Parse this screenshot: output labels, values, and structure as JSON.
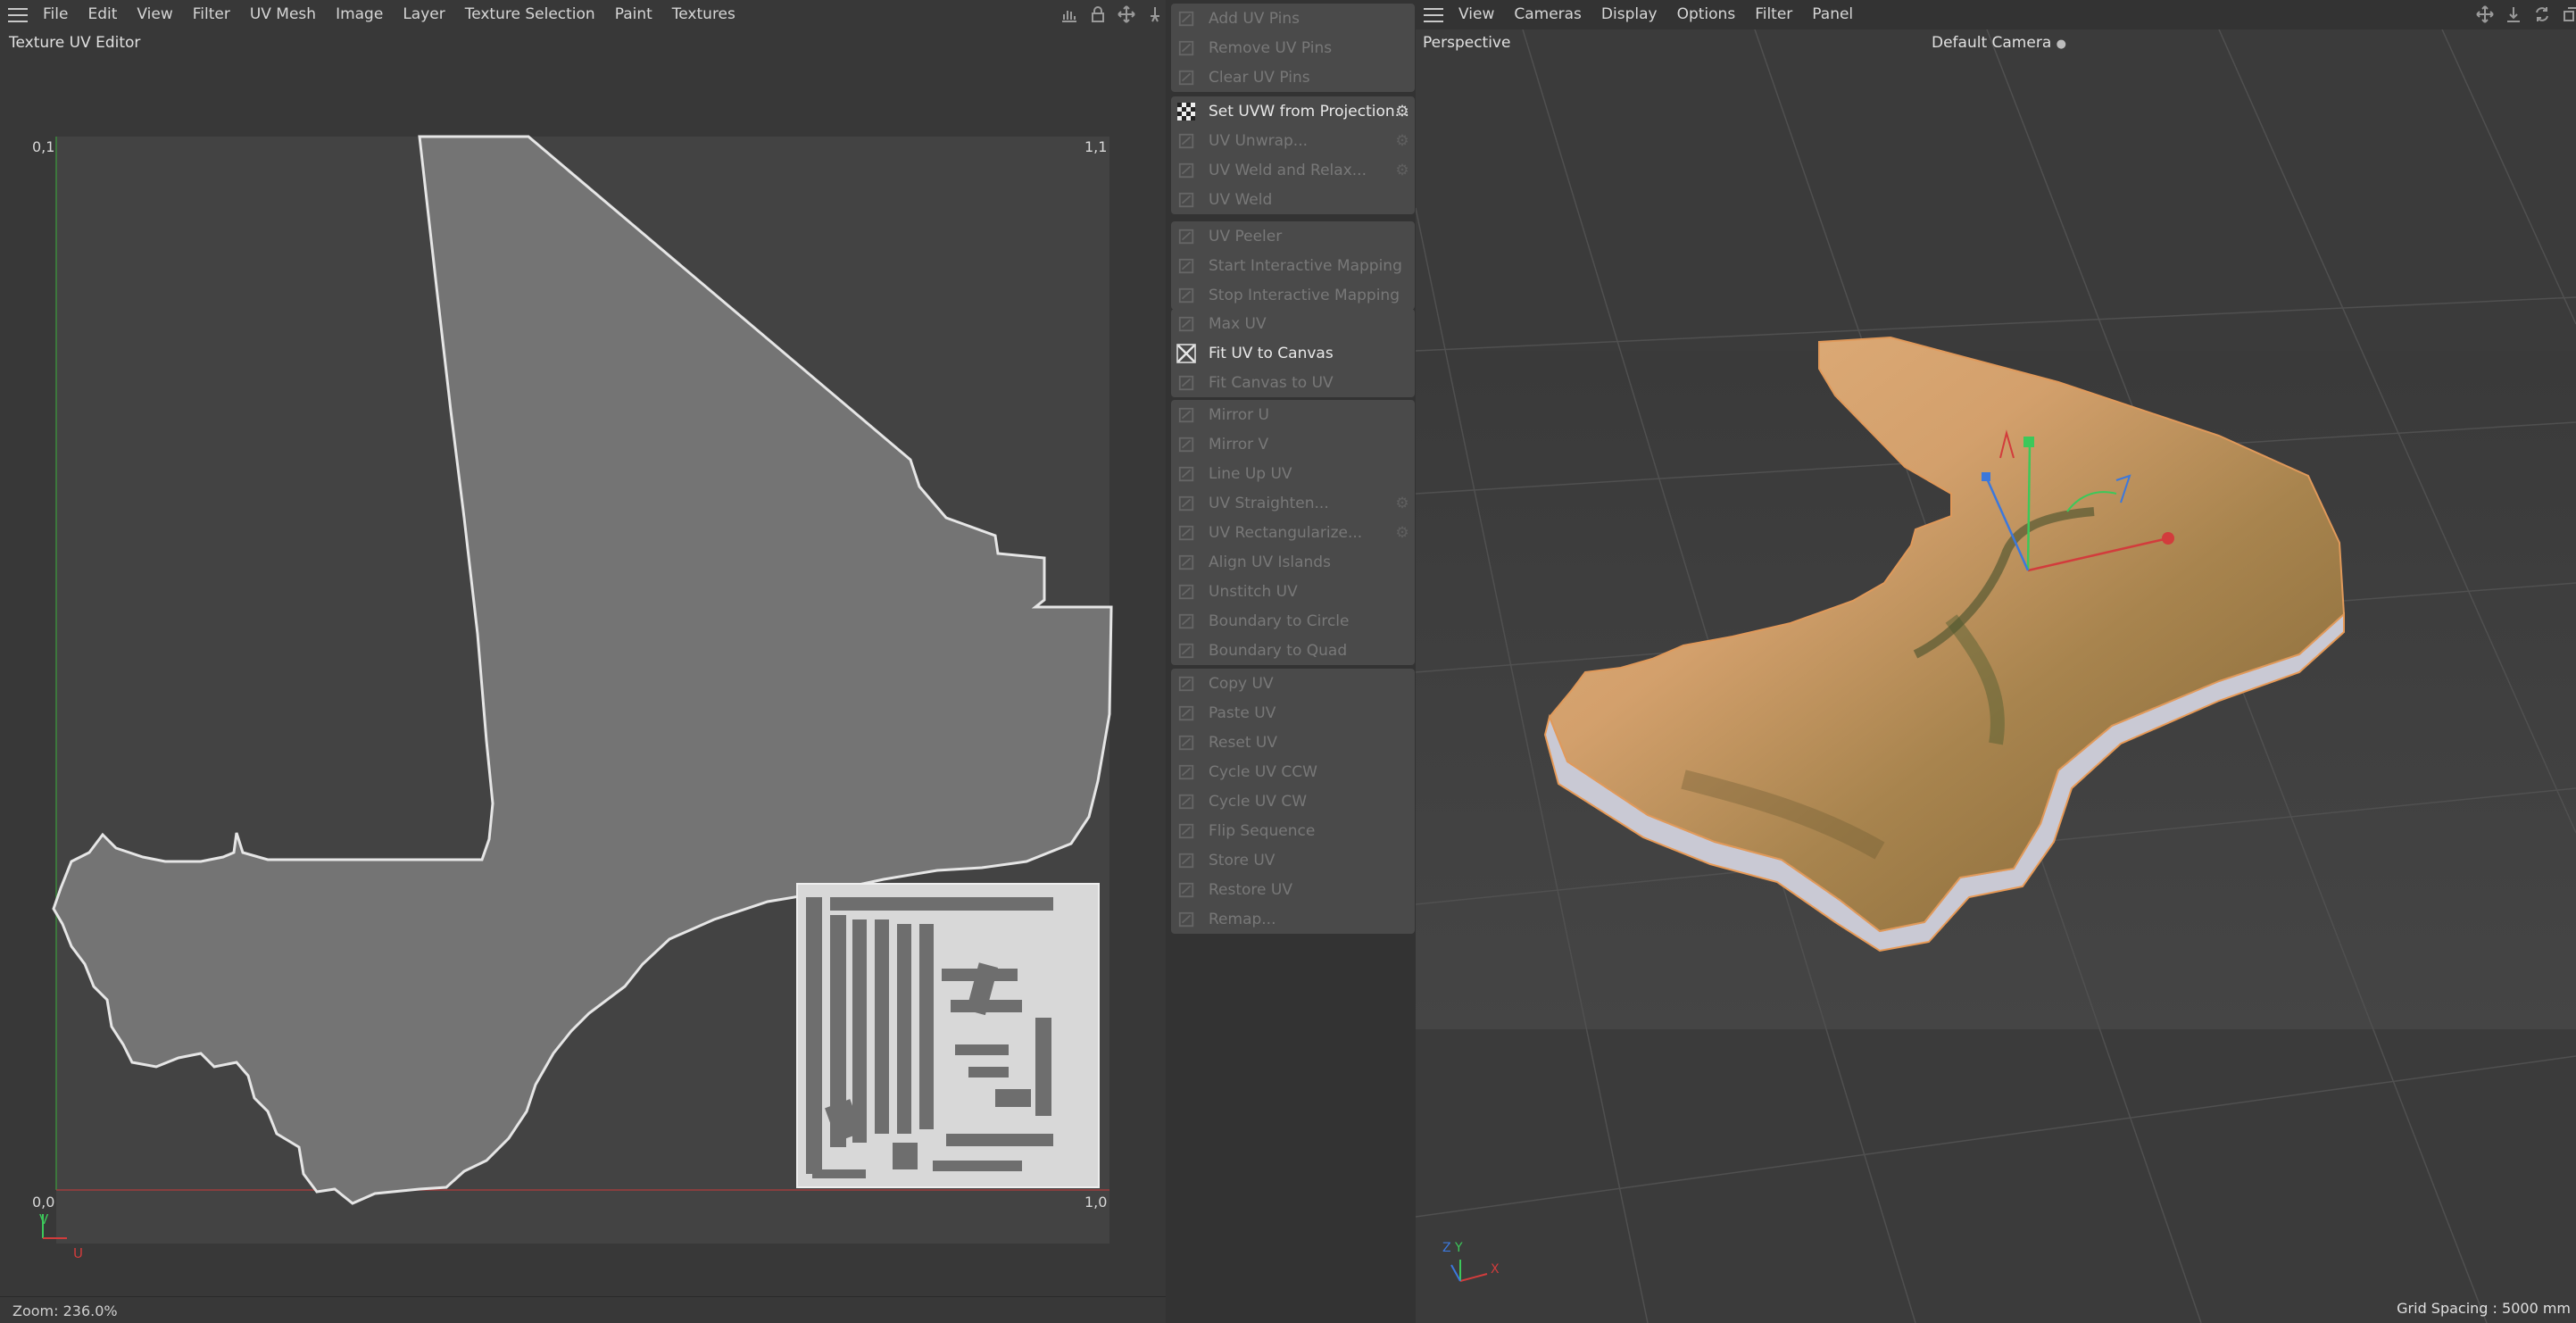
{
  "uv_editor": {
    "menu": [
      "File",
      "Edit",
      "View",
      "Filter",
      "UV Mesh",
      "Image",
      "Layer",
      "Texture Selection",
      "Paint",
      "Textures"
    ],
    "title": "Texture UV Editor",
    "corner_labels": {
      "top_left": "0,1",
      "top_right": "1,1",
      "bottom_left": "0,0",
      "bottom_right": "1,0"
    },
    "axis_labels": {
      "v": "V",
      "u": "U"
    },
    "zoom": "Zoom: 236.0%",
    "icons": [
      "histogram-icon",
      "lock-icon",
      "move-icon",
      "pin-icon"
    ]
  },
  "commands": [
    [
      {
        "label": "Add UV Pins",
        "icon": "pin-add-icon",
        "enabled": false
      },
      {
        "label": "Remove UV Pins",
        "icon": "pin-remove-icon",
        "enabled": false
      },
      {
        "label": "Clear UV Pins",
        "icon": "pin-clear-icon",
        "enabled": false
      }
    ],
    [
      {
        "label": "Set UVW from Projection...",
        "icon": "checker-icon",
        "enabled": true,
        "gear": true
      },
      {
        "label": "UV Unwrap...",
        "icon": "unwrap-icon",
        "enabled": false,
        "gear": true
      },
      {
        "label": "UV Weld and Relax...",
        "icon": "weld-relax-icon",
        "enabled": false,
        "gear": true
      },
      {
        "label": "UV Weld",
        "icon": "weld-icon",
        "enabled": false
      }
    ],
    [
      {
        "label": "UV Peeler",
        "icon": "peeler-icon",
        "enabled": false
      },
      {
        "label": "Start Interactive Mapping",
        "icon": "start-mapping-icon",
        "enabled": false
      },
      {
        "label": "Stop Interactive Mapping",
        "icon": "stop-mapping-icon",
        "enabled": false
      }
    ],
    [
      {
        "label": "Max UV",
        "icon": "max-uv-icon",
        "enabled": false
      },
      {
        "label": "Fit UV to Canvas",
        "icon": "fit-uv-icon",
        "enabled": true
      },
      {
        "label": "Fit Canvas to UV",
        "icon": "fit-canvas-icon",
        "enabled": false
      }
    ],
    [
      {
        "label": "Mirror U",
        "icon": "mirror-u-icon",
        "enabled": false
      },
      {
        "label": "Mirror V",
        "icon": "mirror-v-icon",
        "enabled": false
      },
      {
        "label": "Line Up UV",
        "icon": "line-up-icon",
        "enabled": false
      },
      {
        "label": "UV Straighten...",
        "icon": "straighten-icon",
        "enabled": false,
        "gear": true
      },
      {
        "label": "UV Rectangularize...",
        "icon": "rectangularize-icon",
        "enabled": false,
        "gear": true
      },
      {
        "label": "Align UV Islands",
        "icon": "align-islands-icon",
        "enabled": false
      },
      {
        "label": "Unstitch UV",
        "icon": "unstitch-icon",
        "enabled": false
      },
      {
        "label": "Boundary to Circle",
        "icon": "boundary-circle-icon",
        "enabled": false
      },
      {
        "label": "Boundary to Quad",
        "icon": "boundary-quad-icon",
        "enabled": false
      }
    ],
    [
      {
        "label": "Copy UV",
        "icon": "copy-icon",
        "enabled": false
      },
      {
        "label": "Paste UV",
        "icon": "paste-icon",
        "enabled": false
      },
      {
        "label": "Reset UV",
        "icon": "reset-icon",
        "enabled": false
      },
      {
        "label": "Cycle UV CCW",
        "icon": "cycle-ccw-icon",
        "enabled": false
      },
      {
        "label": "Cycle UV CW",
        "icon": "cycle-cw-icon",
        "enabled": false
      },
      {
        "label": "Flip Sequence",
        "icon": "flip-icon",
        "enabled": false
      },
      {
        "label": "Store UV",
        "icon": "store-icon",
        "enabled": false
      },
      {
        "label": "Restore UV",
        "icon": "restore-icon",
        "enabled": false
      },
      {
        "label": "Remap...",
        "icon": "remap-icon",
        "enabled": false
      }
    ]
  ],
  "viewport": {
    "menu": [
      "View",
      "Cameras",
      "Display",
      "Options",
      "Filter",
      "Panel"
    ],
    "title": "Perspective",
    "camera": "Default Camera",
    "grid_spacing": "Grid Spacing : 5000 mm",
    "axis_labels": {
      "x": "X",
      "y": "Y",
      "z": "Z"
    },
    "icons": [
      "move-view-icon",
      "dolly-icon",
      "rotate-view-icon",
      "maximize-icon"
    ]
  },
  "colors": {
    "uv_shape_fill": "#747474",
    "uv_shape_stroke": "#e6e6e6",
    "canvas_bg": "#434343",
    "accent_red": "#d23c3c",
    "accent_green": "#3cc85a",
    "accent_blue": "#3c78dc"
  }
}
